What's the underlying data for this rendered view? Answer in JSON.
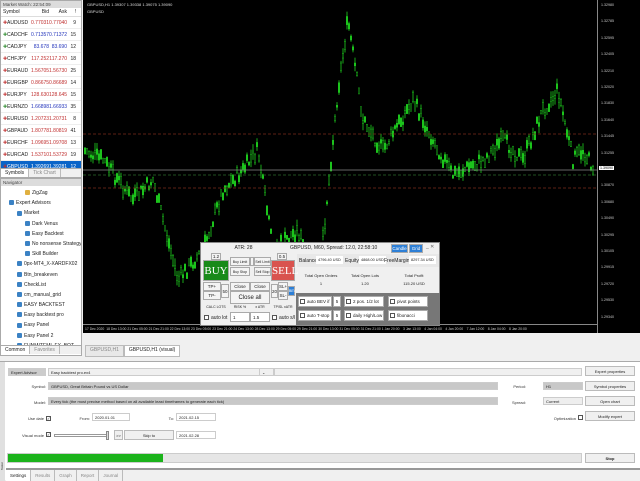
{
  "market_watch": {
    "title": "Market Watch: 22:54:09",
    "headers": [
      "Symbol",
      "Bid",
      "Ask",
      "!"
    ],
    "rows": [
      {
        "s": "AUDUSD",
        "bid": "0.77031",
        "ask": "0.77040",
        "sp": "9",
        "dir": "dn"
      },
      {
        "s": "CADCHF",
        "bid": "0.71357",
        "ask": "0.71372",
        "sp": "15",
        "dir": "up"
      },
      {
        "s": "CADJPY",
        "bid": "83.678",
        "ask": "83.690",
        "sp": "12",
        "dir": "up"
      },
      {
        "s": "CHFJPY",
        "bid": "117.252",
        "ask": "117.270",
        "sp": "18",
        "dir": "dn"
      },
      {
        "s": "EURAUD",
        "bid": "1.56705",
        "ask": "1.56730",
        "sp": "25",
        "dir": "dn"
      },
      {
        "s": "EURGBP",
        "bid": "0.86675",
        "ask": "0.86689",
        "sp": "14",
        "dir": "dn"
      },
      {
        "s": "EURJPY",
        "bid": "128.630",
        "ask": "128.645",
        "sp": "15",
        "dir": "dn"
      },
      {
        "s": "EURNZD",
        "bid": "1.66898",
        "ask": "1.66933",
        "sp": "35",
        "dir": "up"
      },
      {
        "s": "EURUSD",
        "bid": "1.20723",
        "ask": "1.20731",
        "sp": "8",
        "dir": "dn"
      },
      {
        "s": "GBPAUD",
        "bid": "1.80778",
        "ask": "1.80819",
        "sp": "41",
        "dir": "dn"
      },
      {
        "s": "EURCHF",
        "bid": "1.09695",
        "ask": "1.09708",
        "sp": "13",
        "dir": "dn"
      },
      {
        "s": "EURCAD",
        "bid": "1.53710",
        "ask": "1.53729",
        "sp": "19",
        "dir": "dn"
      },
      {
        "s": "GBPUSD",
        "bid": "1.39269",
        "ask": "1.39281",
        "sp": "12",
        "dir": "dn"
      }
    ],
    "tabs": [
      "Symbols",
      "Tick Chart"
    ]
  },
  "navigator": {
    "title": "Navigator",
    "items": [
      {
        "t": "ZigZag",
        "l": 3
      },
      {
        "t": "Expert Advisors",
        "l": 1
      },
      {
        "t": "Market",
        "l": 2
      },
      {
        "t": "Dark Venus",
        "l": 3
      },
      {
        "t": "Easy Backtest",
        "l": 3
      },
      {
        "t": "No nonsense Strategy Te",
        "l": 3
      },
      {
        "t": "Skill Builder",
        "l": 3
      },
      {
        "t": "0px-MT4_X-XARDFX02",
        "l": 2
      },
      {
        "t": "Btn_breakeven",
        "l": 2
      },
      {
        "t": "CheckList",
        "l": 2
      },
      {
        "t": "cm_manual_grid",
        "l": 2
      },
      {
        "t": "EASY BACKTEST",
        "l": 2
      },
      {
        "t": "Easy backtest pro",
        "l": 2
      },
      {
        "t": "Easy Panel",
        "l": 2
      },
      {
        "t": "Easy Panel 2",
        "l": 2
      },
      {
        "t": "FUNMITEMI_FX_BOT",
        "l": 2
      }
    ],
    "tabs": [
      "Common",
      "Favorites"
    ]
  },
  "chart": {
    "info": "GBPUSD,H1  1.39307 1.39338 1.39075 1.39090",
    "symbol": "GBPUSD",
    "current_price": "1.39090",
    "prices": [
      "1.32980",
      "1.32785",
      "1.32595",
      "1.32405",
      "1.32210",
      "1.32020",
      "1.31830",
      "1.31640",
      "1.31445",
      "1.31255",
      "1.31065",
      "1.30870",
      "1.30680",
      "1.30490",
      "1.30295",
      "1.30105",
      "1.29915",
      "1.29720",
      "1.29530",
      "1.29340"
    ],
    "dates": [
      "17 Dec 2020",
      "18 Dec 13:00",
      "21 Dec 05:00",
      "21 Dec 21:00",
      "22 Dec 13:00",
      "23 Dec 05:00",
      "23 Dec 21:00",
      "24 Dec 13:00",
      "28 Dec 13:00",
      "29 Dec 05:00",
      "29 Dec 21:00",
      "30 Dec 13:00",
      "31 Dec 05:00",
      "31 Dec 21:00",
      "1 Jan 20:00",
      "3 Jan 13:00",
      "4 Jan 04:00",
      "4 Jan 20:00",
      "7 Jan 12:00",
      "8 Jan 04:00",
      "8 Jan 20:00"
    ],
    "tabs": [
      "GBPUSD,H1",
      "GBPUSD,H1 (visual)"
    ]
  },
  "panel": {
    "atr": "ATR: 28",
    "header": "GBPUSD, M60, Spread: 12.0, 22:58:10",
    "candle": "Candle",
    "grid": "Grid",
    "buy": "BUY",
    "sell": "SELL",
    "buy_lot": "1.2",
    "sell_lot": "0.5",
    "buy_limit": "Buy Limit",
    "sell_limit": "Sell Limit",
    "buy_stop": "Buy Stop",
    "sell_stop": "Sell Stop",
    "tp_plus": "TP+",
    "tp_minus": "TP-",
    "tp_val": "50",
    "sl_plus": "SL+",
    "sl_minus": "SL-",
    "sl_val": "20",
    "bev": "BEV",
    "close_first": "Close first",
    "close_last": "Close last",
    "close_all": "Close all",
    "calc_lots": "CALC LOTS",
    "risk": "RISK %",
    "xatr": "x ATR",
    "tpsl_atr": "TP/SL xATR",
    "auto_lot": "auto lot",
    "risk_val": "1",
    "xatr_val": "1.5",
    "auto_sl": "auto s/l",
    "balance_lbl": "Balance:",
    "balance": "4796.40 USD",
    "equity_lbl": "Equity:",
    "equity": "4868.00 USD",
    "free_lbl": "FreeMargin:",
    "free": "8297.34 USD",
    "orders_lbl": "Total Open Orders",
    "orders": "1",
    "lots_lbl": "Total Open Lots",
    "lots": "1.20",
    "profit_lbl": "Total Profit",
    "profit": "115.20 USD",
    "auto_bev": "auto BEV  if",
    "auto_bev_val": "5",
    "auto_tstop": "auto T-stop",
    "auto_tstop_val": "5",
    "two_pos": "2 pos. 1/2 lot",
    "daily": "daily High/Low",
    "pivot": "pivot points",
    "fib": "fibonacci"
  },
  "tester": {
    "ea_lbl": "Expert Advisor",
    "ea": "Easy backtest pro.ex4",
    "symbol_lbl": "Symbol:",
    "symbol": "GBPUSD, Great Britain Pound vs US Dollar",
    "model_lbl": "Model:",
    "model": "Every tick (the most precise method based on all available least timeframes to generate each tick)",
    "use_date": "Use date",
    "from_lbl": "From:",
    "from": "2020.01.01",
    "to_lbl": "To:",
    "to": "2021.02.15",
    "visual": "Visual mode",
    "ff": ">>",
    "skip": "Skip to",
    "skip_date": "2021.02.28",
    "period_lbl": "Period:",
    "period": "H1",
    "spread_lbl": "Spread:",
    "spread": "Current",
    "optim": "Optimization",
    "btn_expert": "Expert properties",
    "btn_symbol": "Symbol properties",
    "btn_open": "Open chart",
    "btn_modify": "Modify expert",
    "stop": "Stop",
    "progress": 0.27,
    "tabs": [
      "Settings",
      "Results",
      "Graph",
      "Report",
      "Journal"
    ],
    "side": "Tester"
  }
}
